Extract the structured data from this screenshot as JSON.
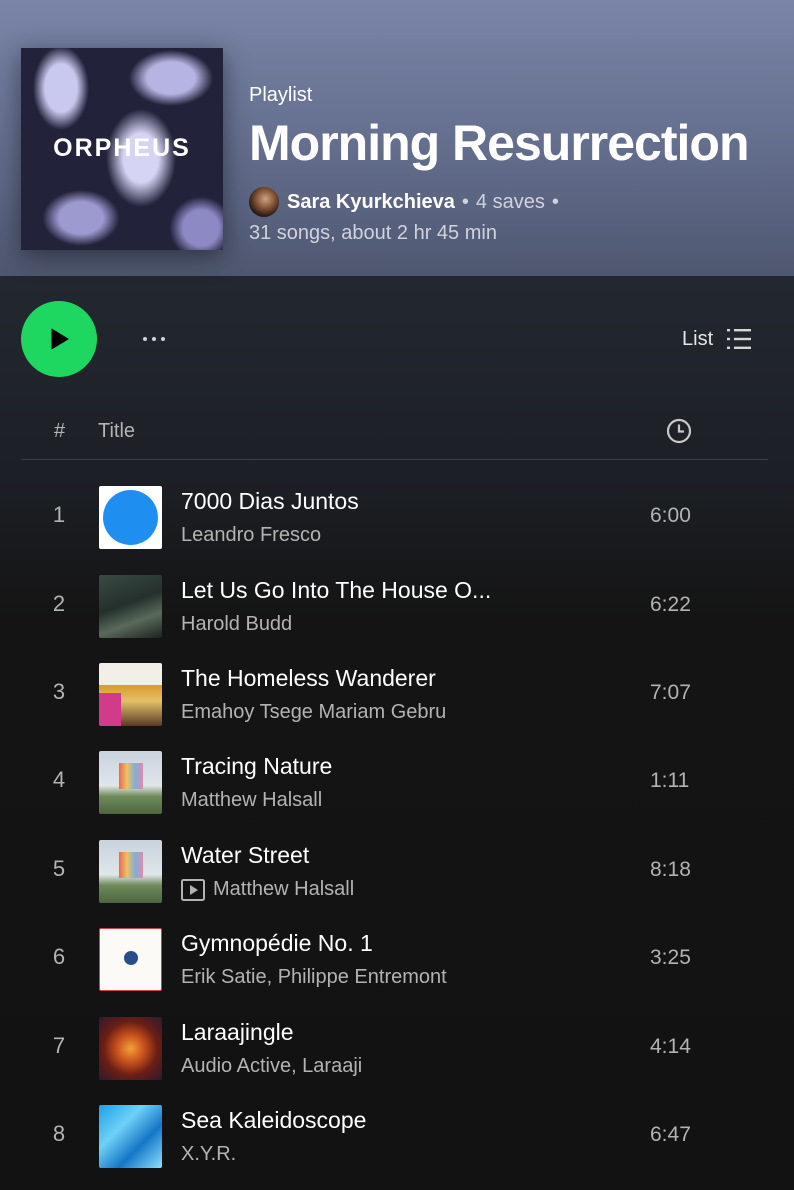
{
  "playlist": {
    "cover_text": "ORPHEUS",
    "kind": "Playlist",
    "title": "Morning Resurrection",
    "owner": "Sara Kyurkchieva",
    "saves": "4 saves",
    "dot1": "•",
    "dot2": "•",
    "info": "31 songs, about 2 hr 45 min"
  },
  "controls": {
    "view_label": "List",
    "play_icon": "play-icon",
    "more_icon": "more-icon",
    "list_icon": "list-view-icon"
  },
  "columns": {
    "num": "#",
    "title": "Title",
    "duration_icon": "clock-icon"
  },
  "tracks": [
    {
      "num": "1",
      "title": "7000 Dias Juntos",
      "artist": "Leandro Fresco",
      "duration": "6:00",
      "video": false
    },
    {
      "num": "2",
      "title": "Let Us Go Into The House O...",
      "artist": "Harold Budd",
      "duration": "6:22",
      "video": false
    },
    {
      "num": "3",
      "title": "The Homeless Wanderer",
      "artist": "Emahoy Tsege Mariam Gebru",
      "duration": "7:07",
      "video": false
    },
    {
      "num": "4",
      "title": "Tracing Nature",
      "artist": "Matthew Halsall",
      "duration": "1:11",
      "video": false
    },
    {
      "num": "5",
      "title": "Water Street",
      "artist": "Matthew Halsall",
      "duration": "8:18",
      "video": true
    },
    {
      "num": "6",
      "title": "Gymnopédie No. 1",
      "artist": "Erik Satie, Philippe Entremont",
      "duration": "3:25",
      "video": false
    },
    {
      "num": "7",
      "title": "Laraajingle",
      "artist": "Audio Active, Laraaji",
      "duration": "4:14",
      "video": false
    },
    {
      "num": "8",
      "title": "Sea Kaleidoscope",
      "artist": "X.Y.R.",
      "duration": "6:47",
      "video": false
    }
  ],
  "colors": {
    "accent": "#1ed760",
    "header_top": "#7a85a8",
    "background": "#121212",
    "secondary_text": "#b3b3b3"
  }
}
